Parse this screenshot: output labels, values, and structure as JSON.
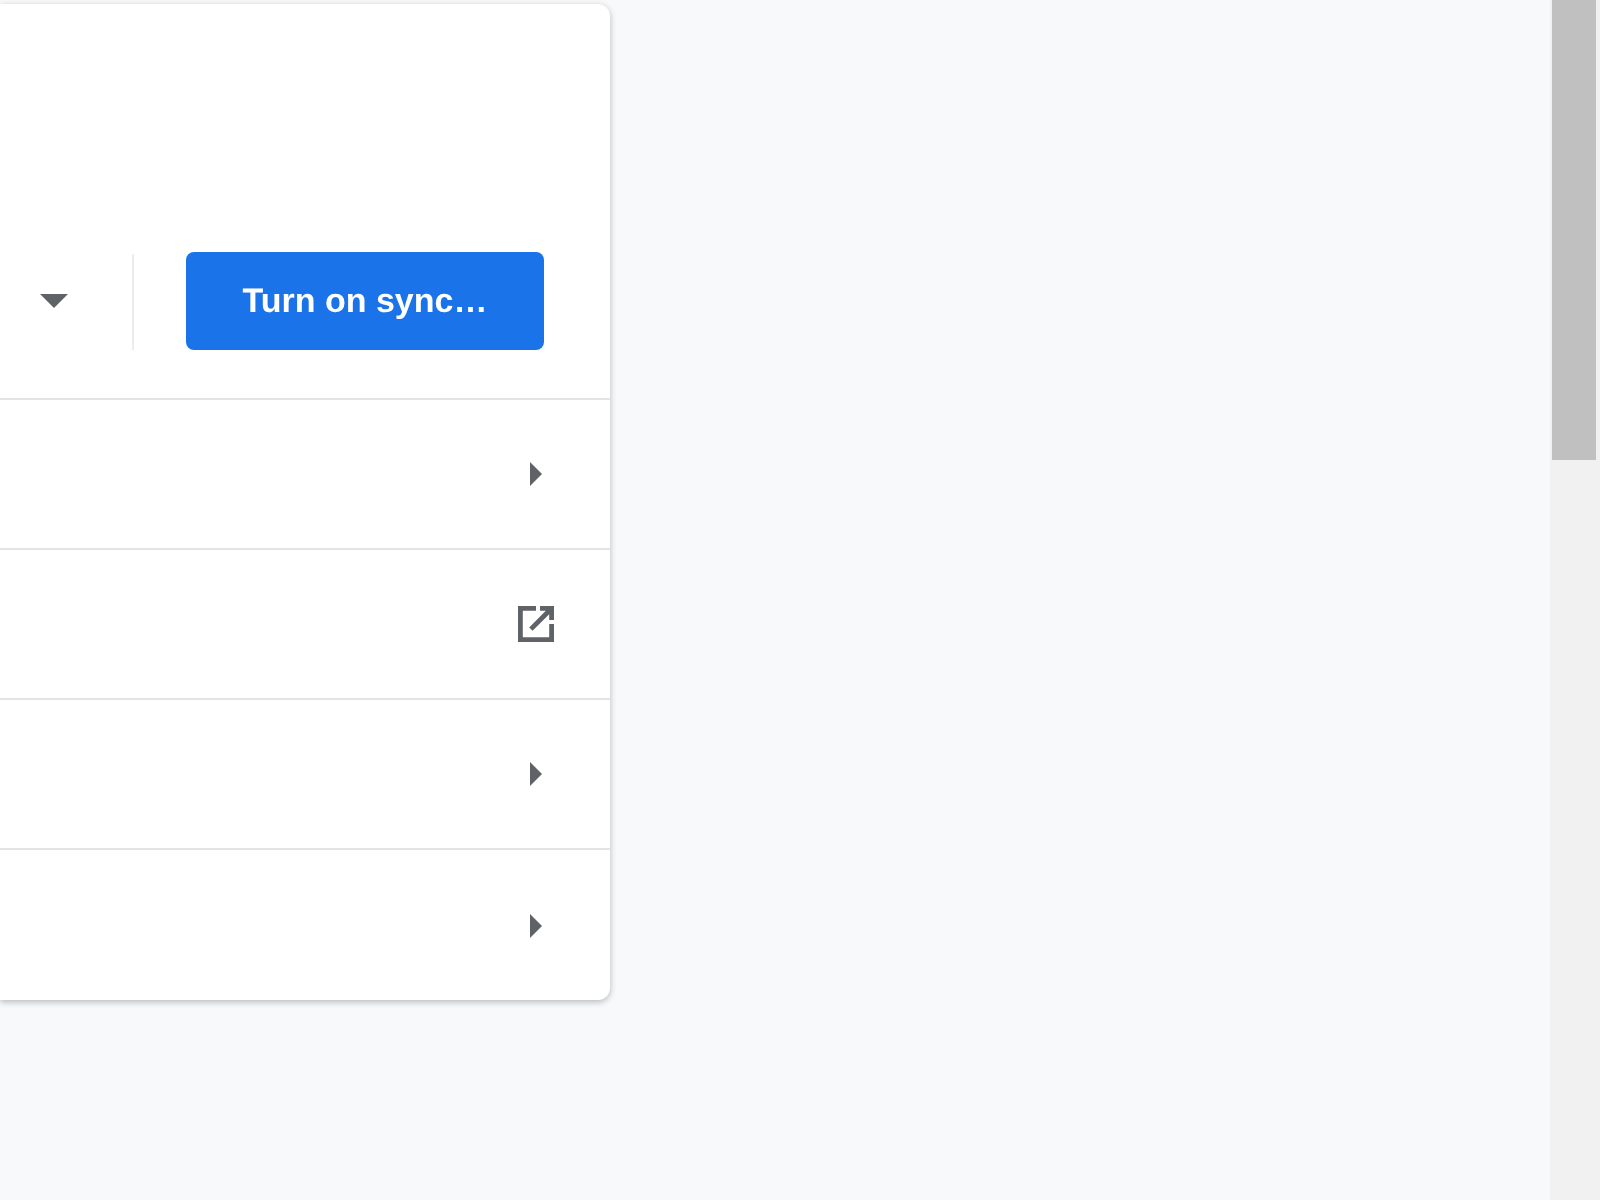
{
  "sync_button": {
    "label": "Turn on sync…"
  },
  "rows": [
    {
      "kind": "submenu"
    },
    {
      "kind": "external"
    },
    {
      "kind": "submenu"
    },
    {
      "kind": "submenu"
    }
  ]
}
